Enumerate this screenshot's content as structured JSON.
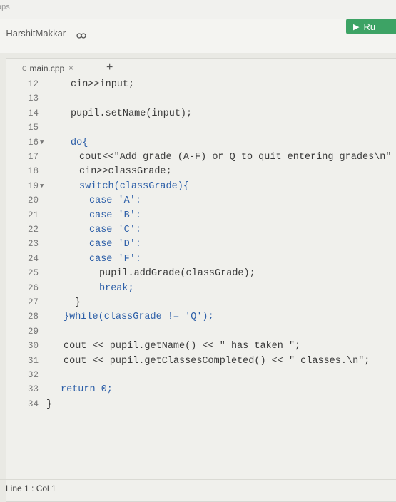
{
  "topbar": {
    "apps_label": "aps"
  },
  "header": {
    "project_title": "-HarshitMakkar",
    "run_label": "Ru"
  },
  "editor": {
    "tab_name": "main.cpp",
    "tab_close": "×",
    "tab_add": "+",
    "lines": [
      {
        "num": "12",
        "code": "cin>>input;"
      },
      {
        "num": "13",
        "code": ""
      },
      {
        "num": "14",
        "code": "pupil.setName(input);"
      },
      {
        "num": "15",
        "code": ""
      },
      {
        "num": "16",
        "code": "do{"
      },
      {
        "num": "17",
        "code": "cout<<\"Add grade (A-F) or Q to quit entering grades\\n\""
      },
      {
        "num": "18",
        "code": "cin>>classGrade;"
      },
      {
        "num": "19",
        "code": "switch(classGrade){"
      },
      {
        "num": "20",
        "code": "case 'A':"
      },
      {
        "num": "21",
        "code": "case 'B':"
      },
      {
        "num": "22",
        "code": "case 'C':"
      },
      {
        "num": "23",
        "code": "case 'D':"
      },
      {
        "num": "24",
        "code": "case 'F':"
      },
      {
        "num": "25",
        "code": "pupil.addGrade(classGrade);"
      },
      {
        "num": "26",
        "code": "break;"
      },
      {
        "num": "27",
        "code": "}"
      },
      {
        "num": "28",
        "code": "}while(classGrade != 'Q');"
      },
      {
        "num": "29",
        "code": ""
      },
      {
        "num": "30",
        "code": "cout << pupil.getName() << \" has taken \";"
      },
      {
        "num": "31",
        "code": "cout << pupil.getClassesCompleted() << \" classes.\\n\";"
      },
      {
        "num": "32",
        "code": ""
      },
      {
        "num": "33",
        "code": "return 0;"
      },
      {
        "num": "34",
        "code": "}"
      }
    ]
  },
  "status_bar": {
    "position": "Line 1 : Col 1"
  }
}
